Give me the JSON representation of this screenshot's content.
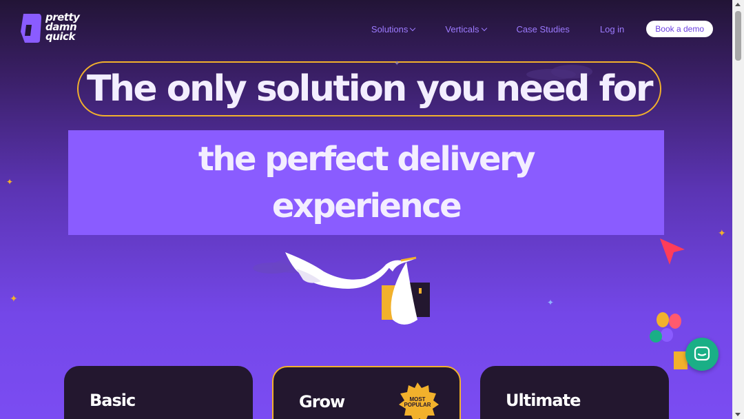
{
  "brand": {
    "logo_lines": [
      "pretty",
      "damn",
      "quick"
    ]
  },
  "nav": {
    "items": [
      {
        "label": "Solutions",
        "has_dropdown": true
      },
      {
        "label": "Verticals",
        "has_dropdown": true
      },
      {
        "label": "Case Studies",
        "has_dropdown": false
      },
      {
        "label": "Log in",
        "has_dropdown": false
      }
    ],
    "cta_label": "Book a demo"
  },
  "hero": {
    "headline": "The only solution you need for",
    "highlight_lines": [
      "the perfect delivery",
      "experience"
    ]
  },
  "pricing": {
    "cards": [
      {
        "title": "Basic"
      },
      {
        "title": "Grow",
        "badge_lines": [
          "MOST",
          "POPULAR"
        ]
      },
      {
        "title": "Ultimate"
      }
    ]
  },
  "colors": {
    "accent_yellow": "#f2b12c",
    "highlight_purple": "#8a5cff",
    "nav_link": "#9d7bff",
    "card_bg": "#23172f",
    "chat_green": "#1aaf86"
  },
  "icons": {
    "chat": "chat-bubble-icon",
    "stork": "stork-illustration",
    "cursor": "cursor-arrow-icon",
    "balloons": "balloons-illustration"
  }
}
